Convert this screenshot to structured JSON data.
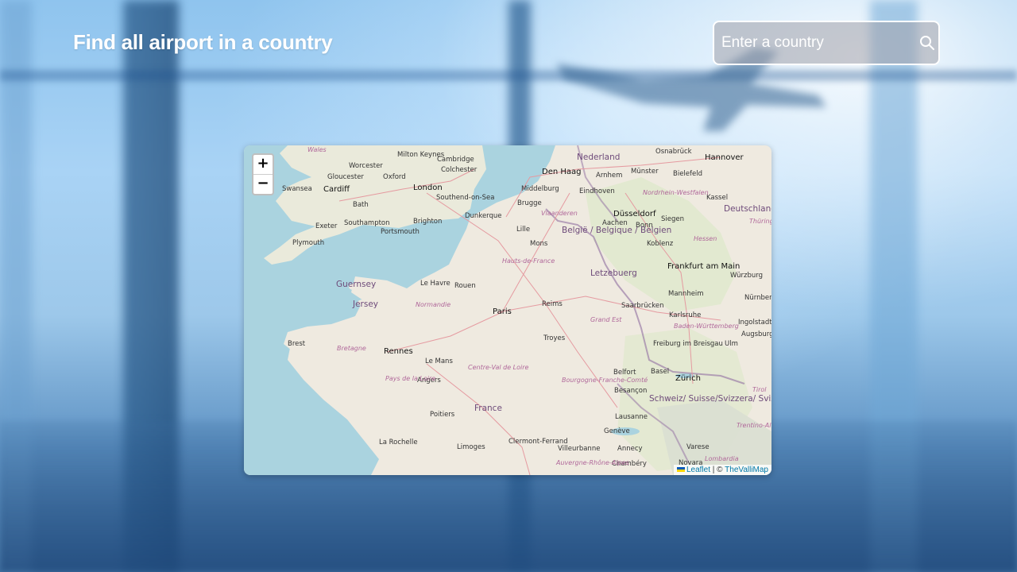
{
  "header": {
    "title": "Find all airport in a country"
  },
  "search": {
    "placeholder": "Enter a country",
    "value": "",
    "icon": "search-icon"
  },
  "map": {
    "zoom_in_label": "+",
    "zoom_out_label": "−",
    "attribution": {
      "leaflet": "Leaflet",
      "separator": "|",
      "copyright": "©",
      "provider": "TheValliMap"
    },
    "places": {
      "cities": [
        "Wales",
        "Milton Keynes",
        "Cambridge",
        "Worcester",
        "Gloucester",
        "Colchester",
        "Oxford",
        "London",
        "Swansea",
        "Cardiff",
        "Bath",
        "Southend-on-Sea",
        "Exeter",
        "Southampton",
        "Brighton",
        "Portsmouth",
        "Plymouth",
        "Dunkerque",
        "Brugge",
        "Middelburg",
        "Den Haag",
        "Nederland",
        "Arnhem",
        "Eindhoven",
        "Münster",
        "Bielefeld",
        "Osnabrück",
        "Hannover",
        "Kassel",
        "Düsseldorf",
        "Aachen",
        "Bonn",
        "Siegen",
        "Lille",
        "Mons",
        "Koblenz",
        "Frankfurt am Main",
        "Würzburg",
        "Le Havre",
        "Rouen",
        "Guernsey",
        "Jersey",
        "Paris",
        "Reims",
        "Saarbrücken",
        "Mannheim",
        "Nürnberg",
        "Karlsruhe",
        "Ingolstadt",
        "Augsburg",
        "Brest",
        "Rennes",
        "Troyes",
        "Freiburg im Breisgau",
        "Ulm",
        "Le Mans",
        "Angers",
        "Basel",
        "Zürich",
        "Belfort",
        "Besançon",
        "France",
        "Poitiers",
        "Lausanne",
        "Genève",
        "Annecy",
        "La Rochelle",
        "Limoges",
        "Clermont-Ferrand",
        "Villeurbanne",
        "Chambéry",
        "Varese",
        "Novara"
      ],
      "countries": [
        "België / Belgique / Belgien",
        "Letzebuerg",
        "Deutschland",
        "Schweiz/ Suisse/Svizzera/ Svizra"
      ],
      "regions": [
        "Vlaanderen",
        "Nordrhein-Westfalen",
        "Hessen",
        "Hauts-de-France",
        "Normandie",
        "Grand Est",
        "Baden-Württemberg",
        "Bretagne",
        "Centre-Val de Loire",
        "Pays de la Loire",
        "Bourgogne-Franche-Comté",
        "Auvergne-Rhône-Alpes",
        "Lombardia",
        "Trentino-Alto Adige/Südtirol",
        "Tirol",
        "Thüringen"
      ]
    }
  },
  "colors": {
    "title": "#ffffff",
    "search_border": "#ffffff",
    "sea": "#aad3df",
    "land": "#efeae0",
    "attribution_link": "#0078a8"
  }
}
